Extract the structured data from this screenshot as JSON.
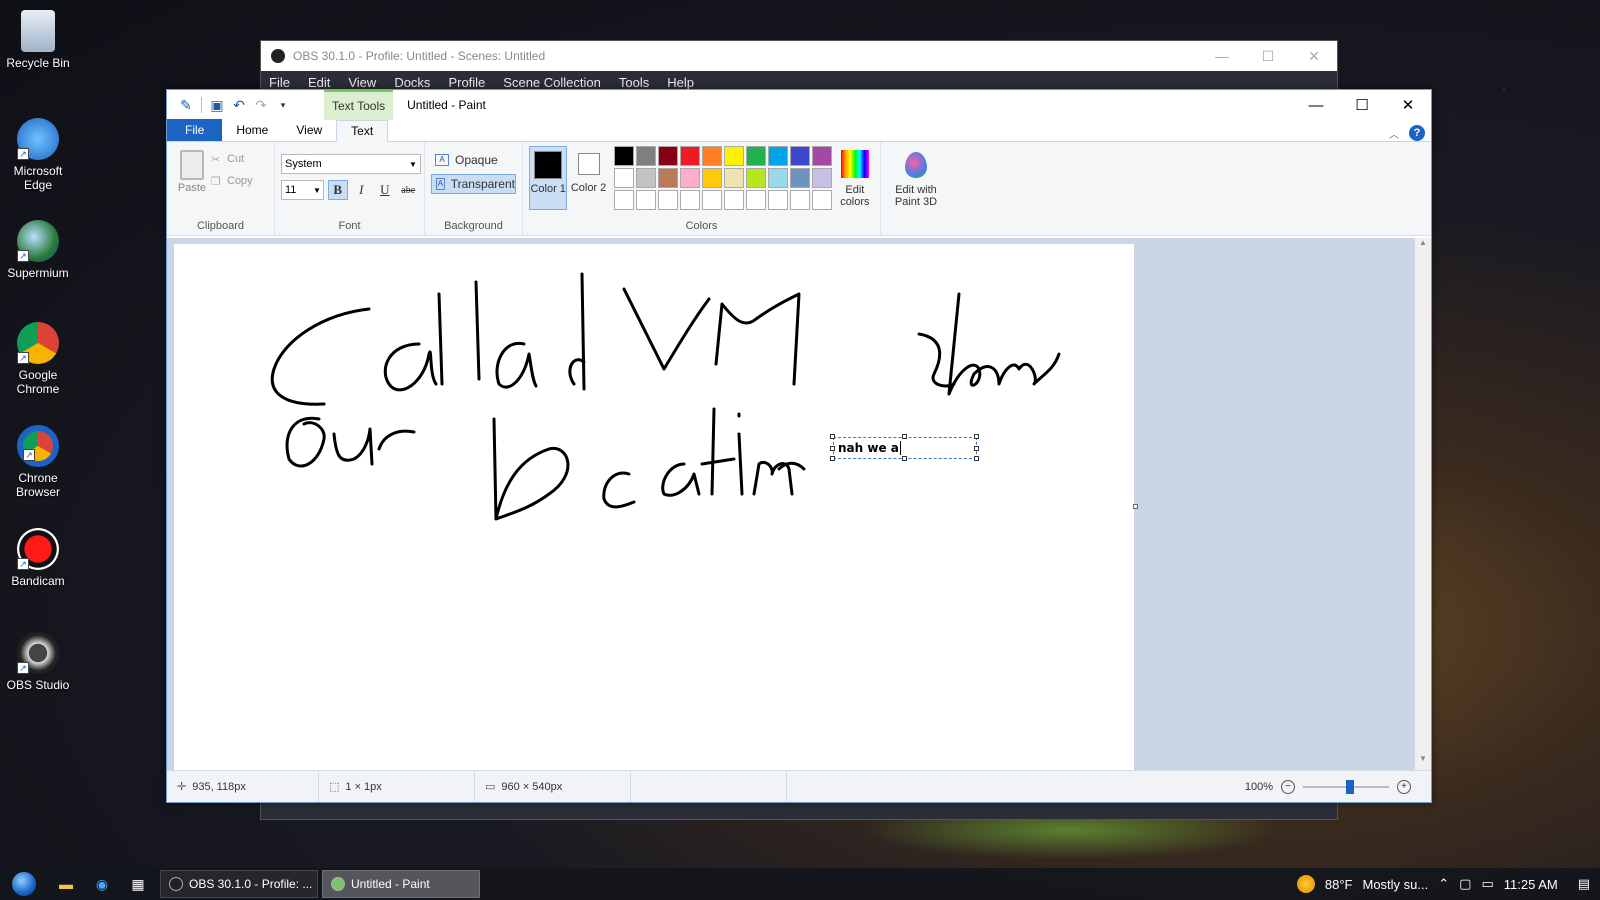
{
  "desktop": {
    "icons": [
      {
        "label": "Recycle Bin"
      },
      {
        "label": "Microsoft Edge"
      },
      {
        "label": "Supermium"
      },
      {
        "label": "Google Chrome"
      },
      {
        "label": "Chrone Browser"
      },
      {
        "label": "Bandicam"
      },
      {
        "label": "OBS Studio"
      }
    ]
  },
  "obs": {
    "title": "OBS 30.1.0 - Profile: Untitled - Scenes: Untitled",
    "menu": [
      "File",
      "Edit",
      "View",
      "Docks",
      "Profile",
      "Scene Collection",
      "Tools",
      "Help"
    ]
  },
  "paint": {
    "title": "Untitled - Paint",
    "context_tab": "Text Tools",
    "tabs": {
      "file": "File",
      "home": "Home",
      "view": "View",
      "text": "Text"
    },
    "clipboard": {
      "paste": "Paste",
      "cut": "Cut",
      "copy": "Copy",
      "label": "Clipboard"
    },
    "font": {
      "family": "System",
      "size": "11",
      "label": "Font",
      "bold": "B",
      "italic": "I",
      "underline": "U",
      "strike": "abe"
    },
    "background": {
      "opaque": "Opaque",
      "transparent": "Transparent",
      "label": "Background"
    },
    "colors": {
      "color1_label": "Color 1",
      "color2_label": "Color 2",
      "edit_label": "Edit colors",
      "label": "Colors",
      "color1": "#000000",
      "color2": "#ffffff",
      "palette": [
        "#000000",
        "#7f7f7f",
        "#880015",
        "#ed1c24",
        "#ff7f27",
        "#fff200",
        "#22b14c",
        "#00a2e8",
        "#3f48cc",
        "#a349a4",
        "#ffffff",
        "#c3c3c3",
        "#b97a57",
        "#ffaec9",
        "#ffc90e",
        "#efe4b0",
        "#b5e61d",
        "#99d9ea",
        "#7092be",
        "#c8bfe7",
        "#ffffff",
        "#ffffff",
        "#ffffff",
        "#ffffff",
        "#ffffff",
        "#ffffff",
        "#ffffff",
        "#ffffff",
        "#ffffff",
        "#ffffff"
      ]
    },
    "paint3d": "Edit with Paint 3D",
    "textbox_text": "nah we a",
    "status": {
      "cursor": "935, 118px",
      "selection": "1 × 1px",
      "size": "960 × 540px",
      "zoom": "100%"
    },
    "zoom_fraction": 0.55
  },
  "taskbar": {
    "tasks": [
      {
        "label": "OBS 30.1.0 - Profile: ..."
      },
      {
        "label": "Untitled - Paint"
      }
    ],
    "weather_temp": "88°F",
    "weather_text": "Mostly su...",
    "time": "11:25 AM"
  }
}
